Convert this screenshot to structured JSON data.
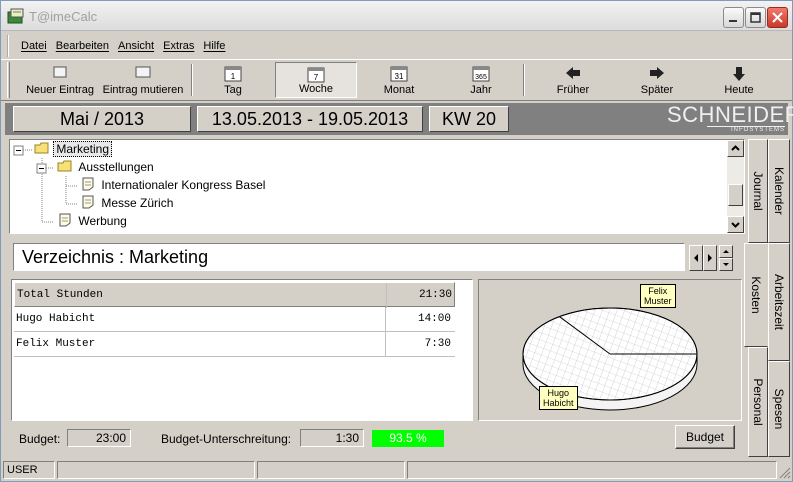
{
  "window": {
    "title": "T@imeCalc"
  },
  "menu": [
    "Datei",
    "Bearbeiten",
    "Ansicht",
    "Extras",
    "Hilfe"
  ],
  "toolbar": {
    "new_entry": "Neuer Eintrag",
    "mutate_entry": "Eintrag mutieren",
    "day": "Tag",
    "day_icon_num": "1",
    "week": "Woche",
    "week_icon_num": "7",
    "month": "Monat",
    "month_icon_num": "31",
    "year": "Jahr",
    "year_icon_num": "365",
    "earlier": "Früher",
    "later": "Später",
    "today": "Heute",
    "selected": "Woche"
  },
  "header": {
    "month": "Mai / 2013",
    "range": "13.05.2013 - 19.05.2013",
    "week": "KW 20",
    "logo_main": "SCHNEIDER",
    "logo_sub": "INFOSYSTEMS"
  },
  "tree": [
    {
      "label": "Marketing",
      "level": 0,
      "type": "folder",
      "selected": true
    },
    {
      "label": "Ausstellungen",
      "level": 1,
      "type": "folder"
    },
    {
      "label": "Internationaler Kongress Basel",
      "level": 2,
      "type": "doc"
    },
    {
      "label": "Messe Zürich",
      "level": 2,
      "type": "doc"
    },
    {
      "label": "Werbung",
      "level": 1,
      "type": "doc"
    }
  ],
  "directory": {
    "label": "Verzeichnis : Marketing"
  },
  "table": {
    "rows": [
      {
        "name": "Total Stunden",
        "hours": "21:30",
        "header": true
      },
      {
        "name": "Hugo Habicht",
        "hours": "14:00"
      },
      {
        "name": "Felix Muster",
        "hours": "7:30"
      }
    ]
  },
  "chart_data": {
    "type": "pie",
    "series": [
      {
        "name": "Hugo Habicht",
        "value": 14.0
      },
      {
        "name": "Felix Muster",
        "value": 7.5
      }
    ],
    "labels": [
      "Hugo Habicht",
      "Felix Muster"
    ],
    "label_lines": [
      [
        "Felix",
        "Muster"
      ],
      [
        "Hugo",
        "Habicht"
      ]
    ]
  },
  "budget": {
    "label": "Budget:",
    "value": "23:00",
    "under_label": "Budget-Unterschreitung:",
    "under_value": "1:30",
    "percent": "93.5 %",
    "percent_color": "#00ff00",
    "button": "Budget"
  },
  "tabs": {
    "inner": [
      "Journal",
      "Kosten",
      "Personal"
    ],
    "outer": [
      "Kalender",
      "Arbeitszeit",
      "Spesen"
    ],
    "active": "Kosten"
  },
  "status": {
    "user": "USER"
  }
}
